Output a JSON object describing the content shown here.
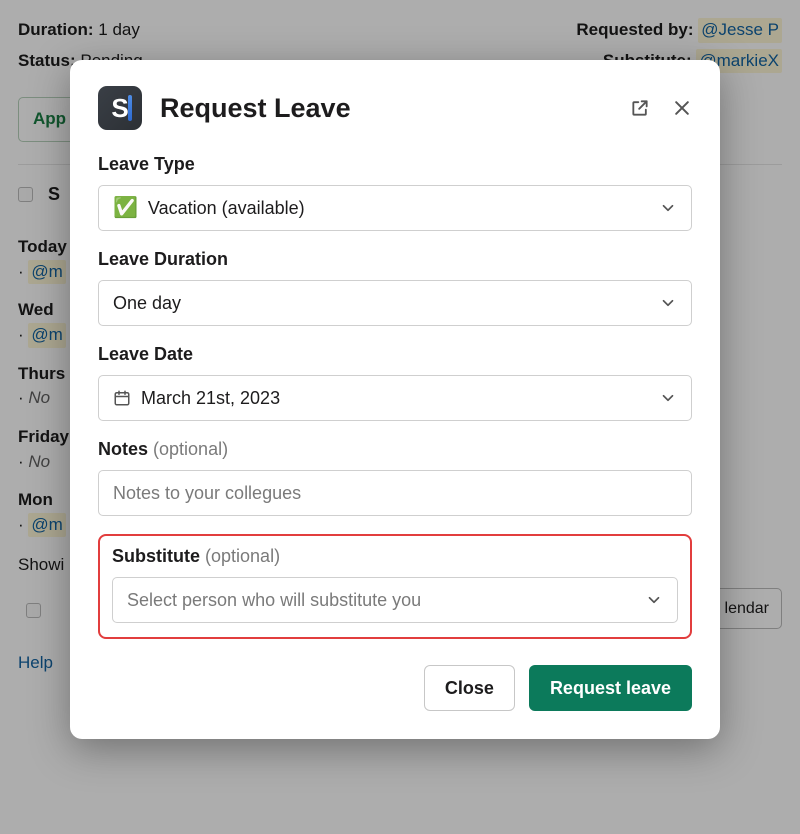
{
  "background": {
    "duration_label": "Duration:",
    "duration_value": "1 day",
    "status_label": "Status:",
    "status_value": "Pending",
    "requested_by_label": "Requested by:",
    "requested_by_value": "@Jesse P",
    "substitute_label": "Substitute:",
    "substitute_value": "@markieX",
    "approve_label": "App",
    "section_s_prefix": "S",
    "days": {
      "today_label": "Today",
      "today_value": "@m",
      "wed_label": "Wed",
      "wed_value": "@m",
      "thurs_label": "Thurs",
      "thurs_value": "No",
      "friday_label": "Friday",
      "friday_value": "No",
      "mon_label": "Mon",
      "mon_value": "@m"
    },
    "showing_prefix": "Showi",
    "calendar_suffix": "lendar",
    "help_label": "Help"
  },
  "modal": {
    "title": "Request Leave",
    "fields": {
      "leave_type": {
        "label": "Leave Type",
        "emoji": "✅",
        "value": "Vacation (available)"
      },
      "leave_duration": {
        "label": "Leave Duration",
        "value": "One day"
      },
      "leave_date": {
        "label": "Leave Date",
        "value": "March 21st, 2023"
      },
      "notes": {
        "label": "Notes",
        "optional": "(optional)",
        "placeholder": "Notes to your collegues"
      },
      "substitute": {
        "label": "Substitute",
        "optional": "(optional)",
        "placeholder": "Select person who will substitute you"
      }
    },
    "buttons": {
      "close": "Close",
      "submit": "Request leave"
    }
  }
}
